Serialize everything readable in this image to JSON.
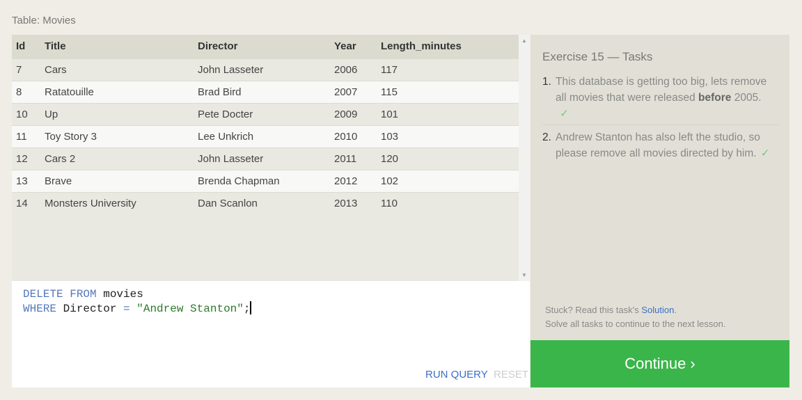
{
  "table_label": "Table: Movies",
  "columns": [
    "Id",
    "Title",
    "Director",
    "Year",
    "Length_minutes"
  ],
  "rows": [
    [
      "7",
      "Cars",
      "John Lasseter",
      "2006",
      "117"
    ],
    [
      "8",
      "Ratatouille",
      "Brad Bird",
      "2007",
      "115"
    ],
    [
      "10",
      "Up",
      "Pete Docter",
      "2009",
      "101"
    ],
    [
      "11",
      "Toy Story 3",
      "Lee Unkrich",
      "2010",
      "103"
    ],
    [
      "12",
      "Cars 2",
      "John Lasseter",
      "2011",
      "120"
    ],
    [
      "13",
      "Brave",
      "Brenda Chapman",
      "2012",
      "102"
    ],
    [
      "14",
      "Monsters University",
      "Dan Scanlon",
      "2013",
      "110"
    ]
  ],
  "editor": {
    "l1_kw": "DELETE FROM",
    "l1_rest": " movies",
    "l2_kw": "WHERE",
    "l2_mid": " Director ",
    "l2_op": "=",
    "l2_str": " \"Andrew Stanton\"",
    "l2_end": ";",
    "run": "RUN QUERY",
    "reset": "RESET"
  },
  "tasks": {
    "title": "Exercise 15 — Tasks",
    "items": [
      {
        "n": "1.",
        "pre": "This database is getting too big, lets remove all movies that were released ",
        "bold": "before",
        "post": " 2005.",
        "check": "✓"
      },
      {
        "n": "2.",
        "pre": "Andrew Stanton has also left the studio, so please remove all movies directed by him.",
        "bold": "",
        "post": "",
        "check": "✓"
      }
    ],
    "stuck_pre": "Stuck? Read this task's ",
    "solution": "Solution",
    "stuck_post": ".",
    "solve": "Solve all tasks to continue to the next lesson."
  },
  "continue": "Continue ›"
}
